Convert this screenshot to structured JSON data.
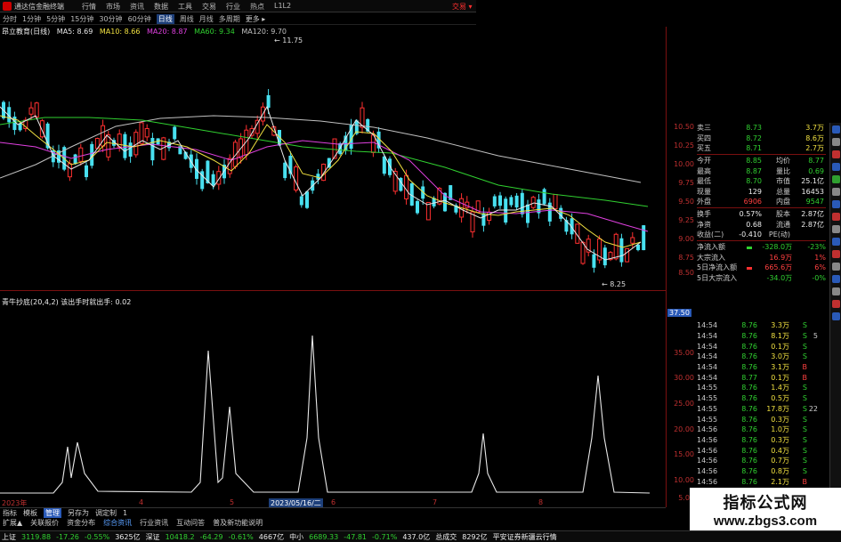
{
  "titlebar": {
    "app_title": "通达信金融终端",
    "menu": [
      "行情",
      "市场",
      "资讯",
      "数据",
      "工具",
      "交易",
      "行业",
      "热点",
      "L1L2"
    ],
    "trade_button": "交易 ▾"
  },
  "periodbar": {
    "periods": [
      "分时",
      "1分钟",
      "5分钟",
      "15分钟",
      "30分钟",
      "60分钟",
      "日线",
      "周线",
      "月线",
      "多周期",
      "更多 ▸"
    ],
    "active_index": 6
  },
  "ma_legend": {
    "stock": "昂立教育(日线)",
    "items": [
      {
        "label": "MA5: 8.69",
        "color": "#e8e8e8"
      },
      {
        "label": "MA10: 8.66",
        "color": "#f0e040"
      },
      {
        "label": "MA20: 8.87",
        "color": "#e040e0"
      },
      {
        "label": "MA60: 9.34",
        "color": "#30d030"
      },
      {
        "label": "MA120: 9.70",
        "color": "#c0c0c0"
      }
    ]
  },
  "main_chart": {
    "high_label": "← 11.75",
    "low_label": "← 8.25"
  },
  "y_axis_main": [
    "10.50",
    "10.25",
    "10.00",
    "9.75",
    "9.50",
    "9.25",
    "9.00",
    "8.75",
    "8.50"
  ],
  "indicator_legend": {
    "name": "青牛抄底(20,4,2)",
    "sub": "该出手时就出手: 0.02",
    "current_value": "37.50"
  },
  "y_axis_ind": [
    "35.00",
    "30.00",
    "25.00",
    "20.00",
    "15.00",
    "10.00",
    "5.00"
  ],
  "date_axis": {
    "start": "2023年",
    "months": [
      "4",
      "5",
      "6",
      "7",
      "8"
    ],
    "highlight": "2023/05/16/二"
  },
  "tabs1": [
    "指标",
    "模板",
    "管理",
    "另存为",
    "调定制",
    "1"
  ],
  "tabs1_selected": 2,
  "tabs2": [
    "扩展▲",
    "关联报价",
    "资金分布",
    "综合资讯",
    "行业资讯",
    "互动问答",
    "普及新功能说明"
  ],
  "tabs2_selected": 3,
  "quote_rows": [
    {
      "l": "卖三",
      "v": "8.73",
      "v_color": "#30d030",
      "r": "",
      "r2": "3.7万",
      "r2_color": "#f0e040"
    },
    {
      "l": "买四",
      "v": "8.72",
      "v_color": "#30d030",
      "r": "",
      "r2": "8.6万",
      "r2_color": "#f0e040"
    },
    {
      "l": "买五",
      "v": "8.71",
      "v_color": "#30d030",
      "r": "",
      "r2": "2.7万",
      "r2_color": "#f0e040"
    },
    {
      "sep": true
    },
    {
      "l": "今开",
      "v": "8.85",
      "v_color": "#30d030",
      "r": "均价",
      "r2": "8.77",
      "r2_color": "#30d030"
    },
    {
      "l": "最高",
      "v": "8.87",
      "v_color": "#30d030",
      "r": "量比",
      "r2": "0.69",
      "r2_color": "#30d030"
    },
    {
      "l": "最低",
      "v": "8.70",
      "v_color": "#30d030",
      "r": "市值",
      "r2": "25.1亿",
      "r2_color": "#eeeeee"
    },
    {
      "l": "现量",
      "v": "129",
      "v_color": "#eeeeee",
      "r": "总量",
      "r2": "16453",
      "r2_color": "#eeeeee"
    },
    {
      "l": "外盘",
      "v": "6906",
      "v_color": "#ff4040",
      "r": "内盘",
      "r2": "9547",
      "r2_color": "#30d030"
    },
    {
      "sep": true
    },
    {
      "l": "换手",
      "v": "0.57%",
      "v_color": "#eeeeee",
      "r": "股本",
      "r2": "2.87亿",
      "r2_color": "#eeeeee"
    },
    {
      "l": "净资",
      "v": "0.68",
      "v_color": "#eeeeee",
      "r": "流通",
      "r2": "2.87亿",
      "r2_color": "#eeeeee"
    },
    {
      "l": "收益(二)",
      "v": "-0.410",
      "v_color": "#eeeeee",
      "r": "PE(动)",
      "r2": "",
      "r2_color": "#eeeeee"
    }
  ],
  "flow_rows": [
    {
      "l": "净流入额",
      "bar": "#30d030",
      "v": "-328.0万",
      "v_color": "#30d030",
      "p": "-23%",
      "p_color": "#30d030"
    },
    {
      "l": "大宗流入",
      "bar": "",
      "v": "16.9万",
      "v_color": "#ff4040",
      "p": "1%",
      "p_color": "#ff4040"
    },
    {
      "l": "5日净流入额",
      "bar": "#ff3030",
      "v": "665.6万",
      "v_color": "#ff4040",
      "p": "6%",
      "p_color": "#ff4040"
    },
    {
      "l": "5日大宗流入",
      "bar": "",
      "v": "-34.0万",
      "v_color": "#30d030",
      "p": "-0%",
      "p_color": "#30d030"
    }
  ],
  "ticks": [
    {
      "t": "14:54",
      "p": "8.76",
      "v": "3.3万",
      "d": "S",
      "n": ""
    },
    {
      "t": "14:54",
      "p": "8.76",
      "v": "8.1万",
      "d": "S",
      "n": "5"
    },
    {
      "t": "14:54",
      "p": "8.76",
      "v": "0.1万",
      "d": "S",
      "n": ""
    },
    {
      "t": "14:54",
      "p": "8.76",
      "v": "3.0万",
      "d": "S",
      "n": ""
    },
    {
      "t": "14:54",
      "p": "8.76",
      "v": "3.1万",
      "d": "B",
      "n": ""
    },
    {
      "t": "14:54",
      "p": "8.77",
      "v": "0.1万",
      "d": "B",
      "n": ""
    },
    {
      "t": "14:55",
      "p": "8.76",
      "v": "1.4万",
      "d": "S",
      "n": ""
    },
    {
      "t": "14:55",
      "p": "8.76",
      "v": "0.5万",
      "d": "S",
      "n": ""
    },
    {
      "t": "14:55",
      "p": "8.76",
      "v": "17.8万",
      "d": "S",
      "n": "22"
    },
    {
      "t": "14:55",
      "p": "8.76",
      "v": "0.3万",
      "d": "S",
      "n": ""
    },
    {
      "t": "14:56",
      "p": "8.76",
      "v": "1.0万",
      "d": "S",
      "n": ""
    },
    {
      "t": "14:56",
      "p": "8.76",
      "v": "0.3万",
      "d": "S",
      "n": ""
    },
    {
      "t": "14:56",
      "p": "8.76",
      "v": "0.4万",
      "d": "S",
      "n": ""
    },
    {
      "t": "14:56",
      "p": "8.76",
      "v": "0.7万",
      "d": "S",
      "n": ""
    },
    {
      "t": "14:56",
      "p": "8.76",
      "v": "0.8万",
      "d": "S",
      "n": ""
    },
    {
      "t": "14:56",
      "p": "8.76",
      "v": "2.1万",
      "d": "B",
      "n": ""
    },
    {
      "t": "14:56",
      "p": "8.75",
      "v": "1.3万",
      "d": "S",
      "n": ""
    },
    {
      "t": "14:56",
      "p": "8.75",
      "v": "4.6万",
      "d": "S",
      "n": ""
    },
    {
      "t": "14:56",
      "p": "8.75",
      "v": "0.7万",
      "d": "S",
      "n": ""
    }
  ],
  "statusbar": {
    "idx1_name": "上证",
    "idx1_val": "3119.88",
    "idx1_chg": "-17.26",
    "idx1_pct": "-0.55%",
    "idx1_amt": "3625亿",
    "idx2_name": "深证",
    "idx2_val": "10418.2",
    "idx2_chg": "-64.29",
    "idx2_pct": "-0.61%",
    "idx2_amt": "4667亿",
    "idx3_name": "中小",
    "idx3_val": "6689.33",
    "idx3_chg": "-47.81",
    "idx3_pct": "-0.71%",
    "idx3_amt": "437.0亿",
    "vol_label": "总成交",
    "vol_val": "8292亿",
    "broker": "平安证券新疆云行情"
  },
  "watermark": {
    "title": "指标公式网",
    "url": "www.zbgs3.com"
  },
  "colors": {
    "up": "#ff4040",
    "down": "#30d030",
    "axis": "#c03030",
    "grid": "#7a1010"
  }
}
